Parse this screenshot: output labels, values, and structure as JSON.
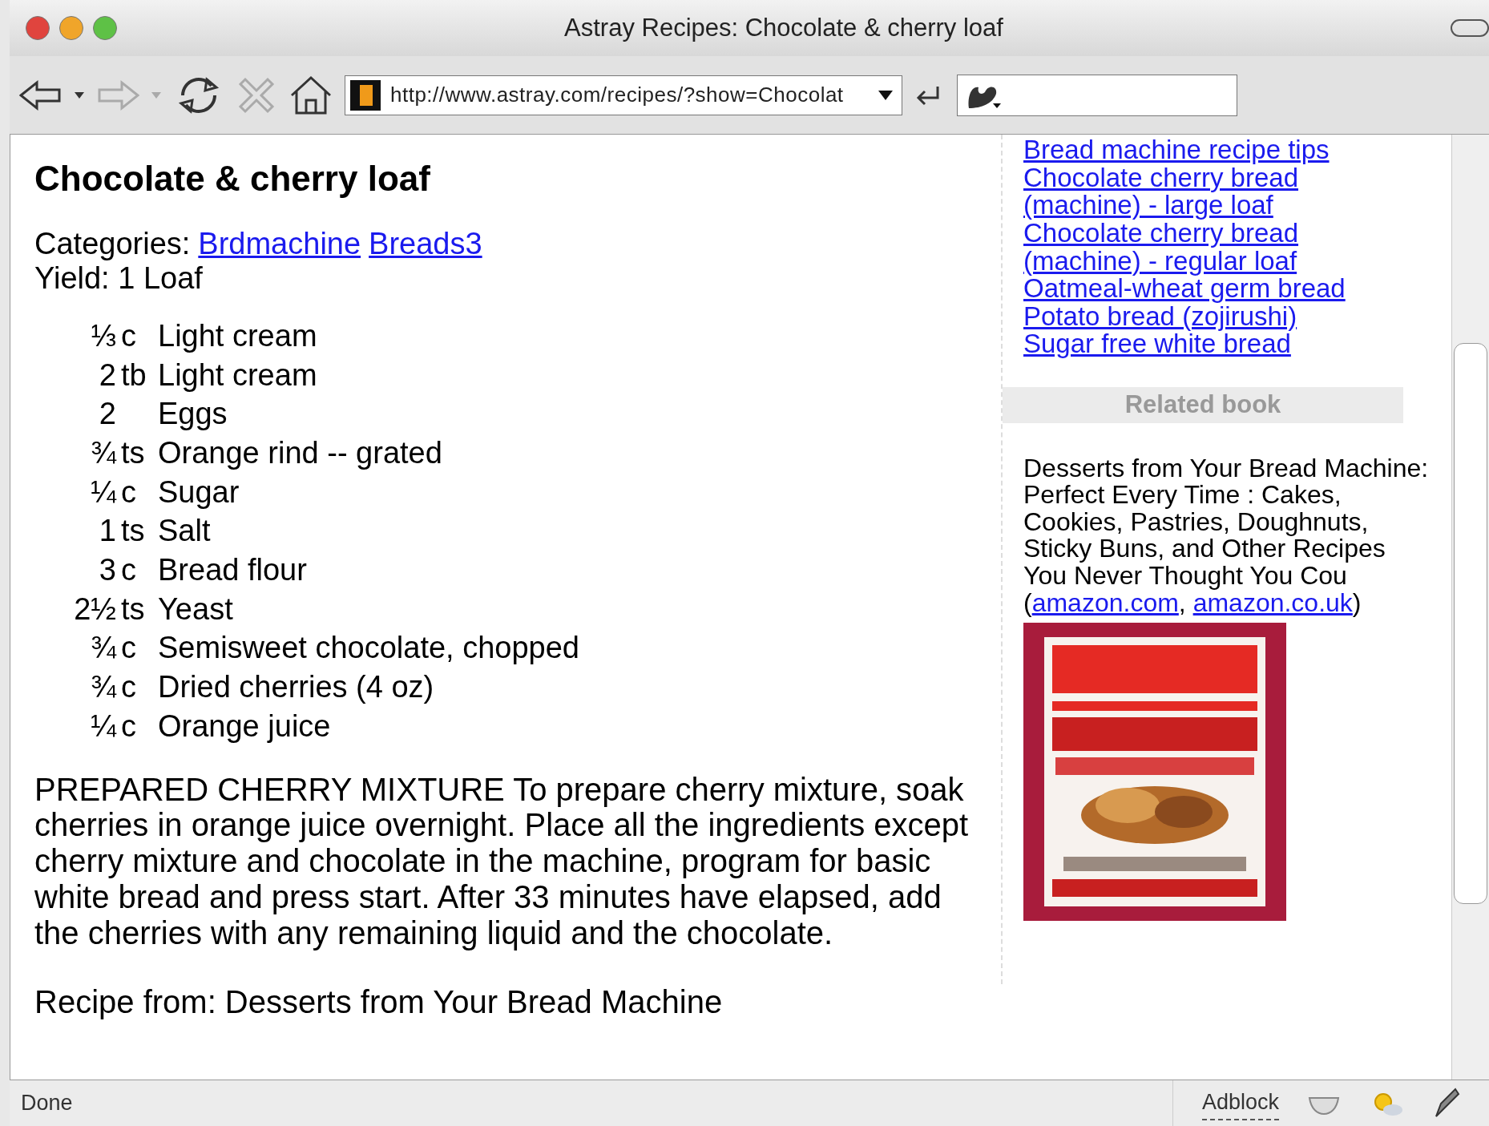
{
  "window": {
    "title": "Astray Recipes: Chocolate & cherry loaf"
  },
  "toolbar": {
    "url": "http://www.astray.com/recipes/?show=Chocolat"
  },
  "recipe": {
    "title": "Chocolate & cherry loaf",
    "categories_label": "Categories:",
    "categories": [
      "Brdmachine",
      "Breads3"
    ],
    "yield": "Yield: 1 Loaf",
    "ingredients": [
      {
        "qty": "⅓",
        "unit": "c",
        "item": "Light cream"
      },
      {
        "qty": "2",
        "unit": "tb",
        "item": "Light cream"
      },
      {
        "qty": "2",
        "item": "Eggs"
      },
      {
        "qty": "¾",
        "unit": "ts",
        "item": "Orange rind -- grated"
      },
      {
        "qty": "¼",
        "unit": "c",
        "item": "Sugar"
      },
      {
        "qty": "1",
        "unit": "ts",
        "item": "Salt"
      },
      {
        "qty": "3",
        "unit": "c",
        "item": "Bread flour"
      },
      {
        "qty": "2½",
        "unit": "ts",
        "item": "Yeast"
      },
      {
        "qty": "¾",
        "unit": "c",
        "item": "Semisweet chocolate, chopped"
      },
      {
        "qty": "¾",
        "unit": "c",
        "item": "Dried cherries (4 oz)"
      },
      {
        "qty": "¼",
        "unit": "c",
        "item": "Orange juice"
      }
    ],
    "directions": "PREPARED CHERRY MIXTURE To prepare cherry mixture, soak cherries in orange juice overnight. Place all the ingredients except cherry mixture and chocolate in the machine, program for basic white bread and press start. After 33 minutes have elapsed, add the cherries with any remaining liquid and the chocolate.",
    "source": "Recipe from: Desserts from Your Bread Machine"
  },
  "sidebar": {
    "links": [
      "Bread machine recipe tips",
      "Chocolate cherry bread (machine) - large loaf",
      "Chocolate cherry bread (machine) - regular loaf",
      "Oatmeal-wheat germ bread",
      "Potato bread (zojirushi)",
      "Sugar free white bread"
    ],
    "related_heading": "Related book",
    "book_text": "Desserts from Your Bread Machine: Perfect Every Time : Cakes, Cookies, Pastries, Doughnuts, Sticky Buns, and Other Recipes You Never Thought You Cou (",
    "book_links": [
      "amazon.com",
      "amazon.co.uk"
    ],
    "book_link_sep": ",",
    "book_text_end": ")"
  },
  "status_bar": {
    "text": "Done",
    "adblock": "Adblock"
  }
}
